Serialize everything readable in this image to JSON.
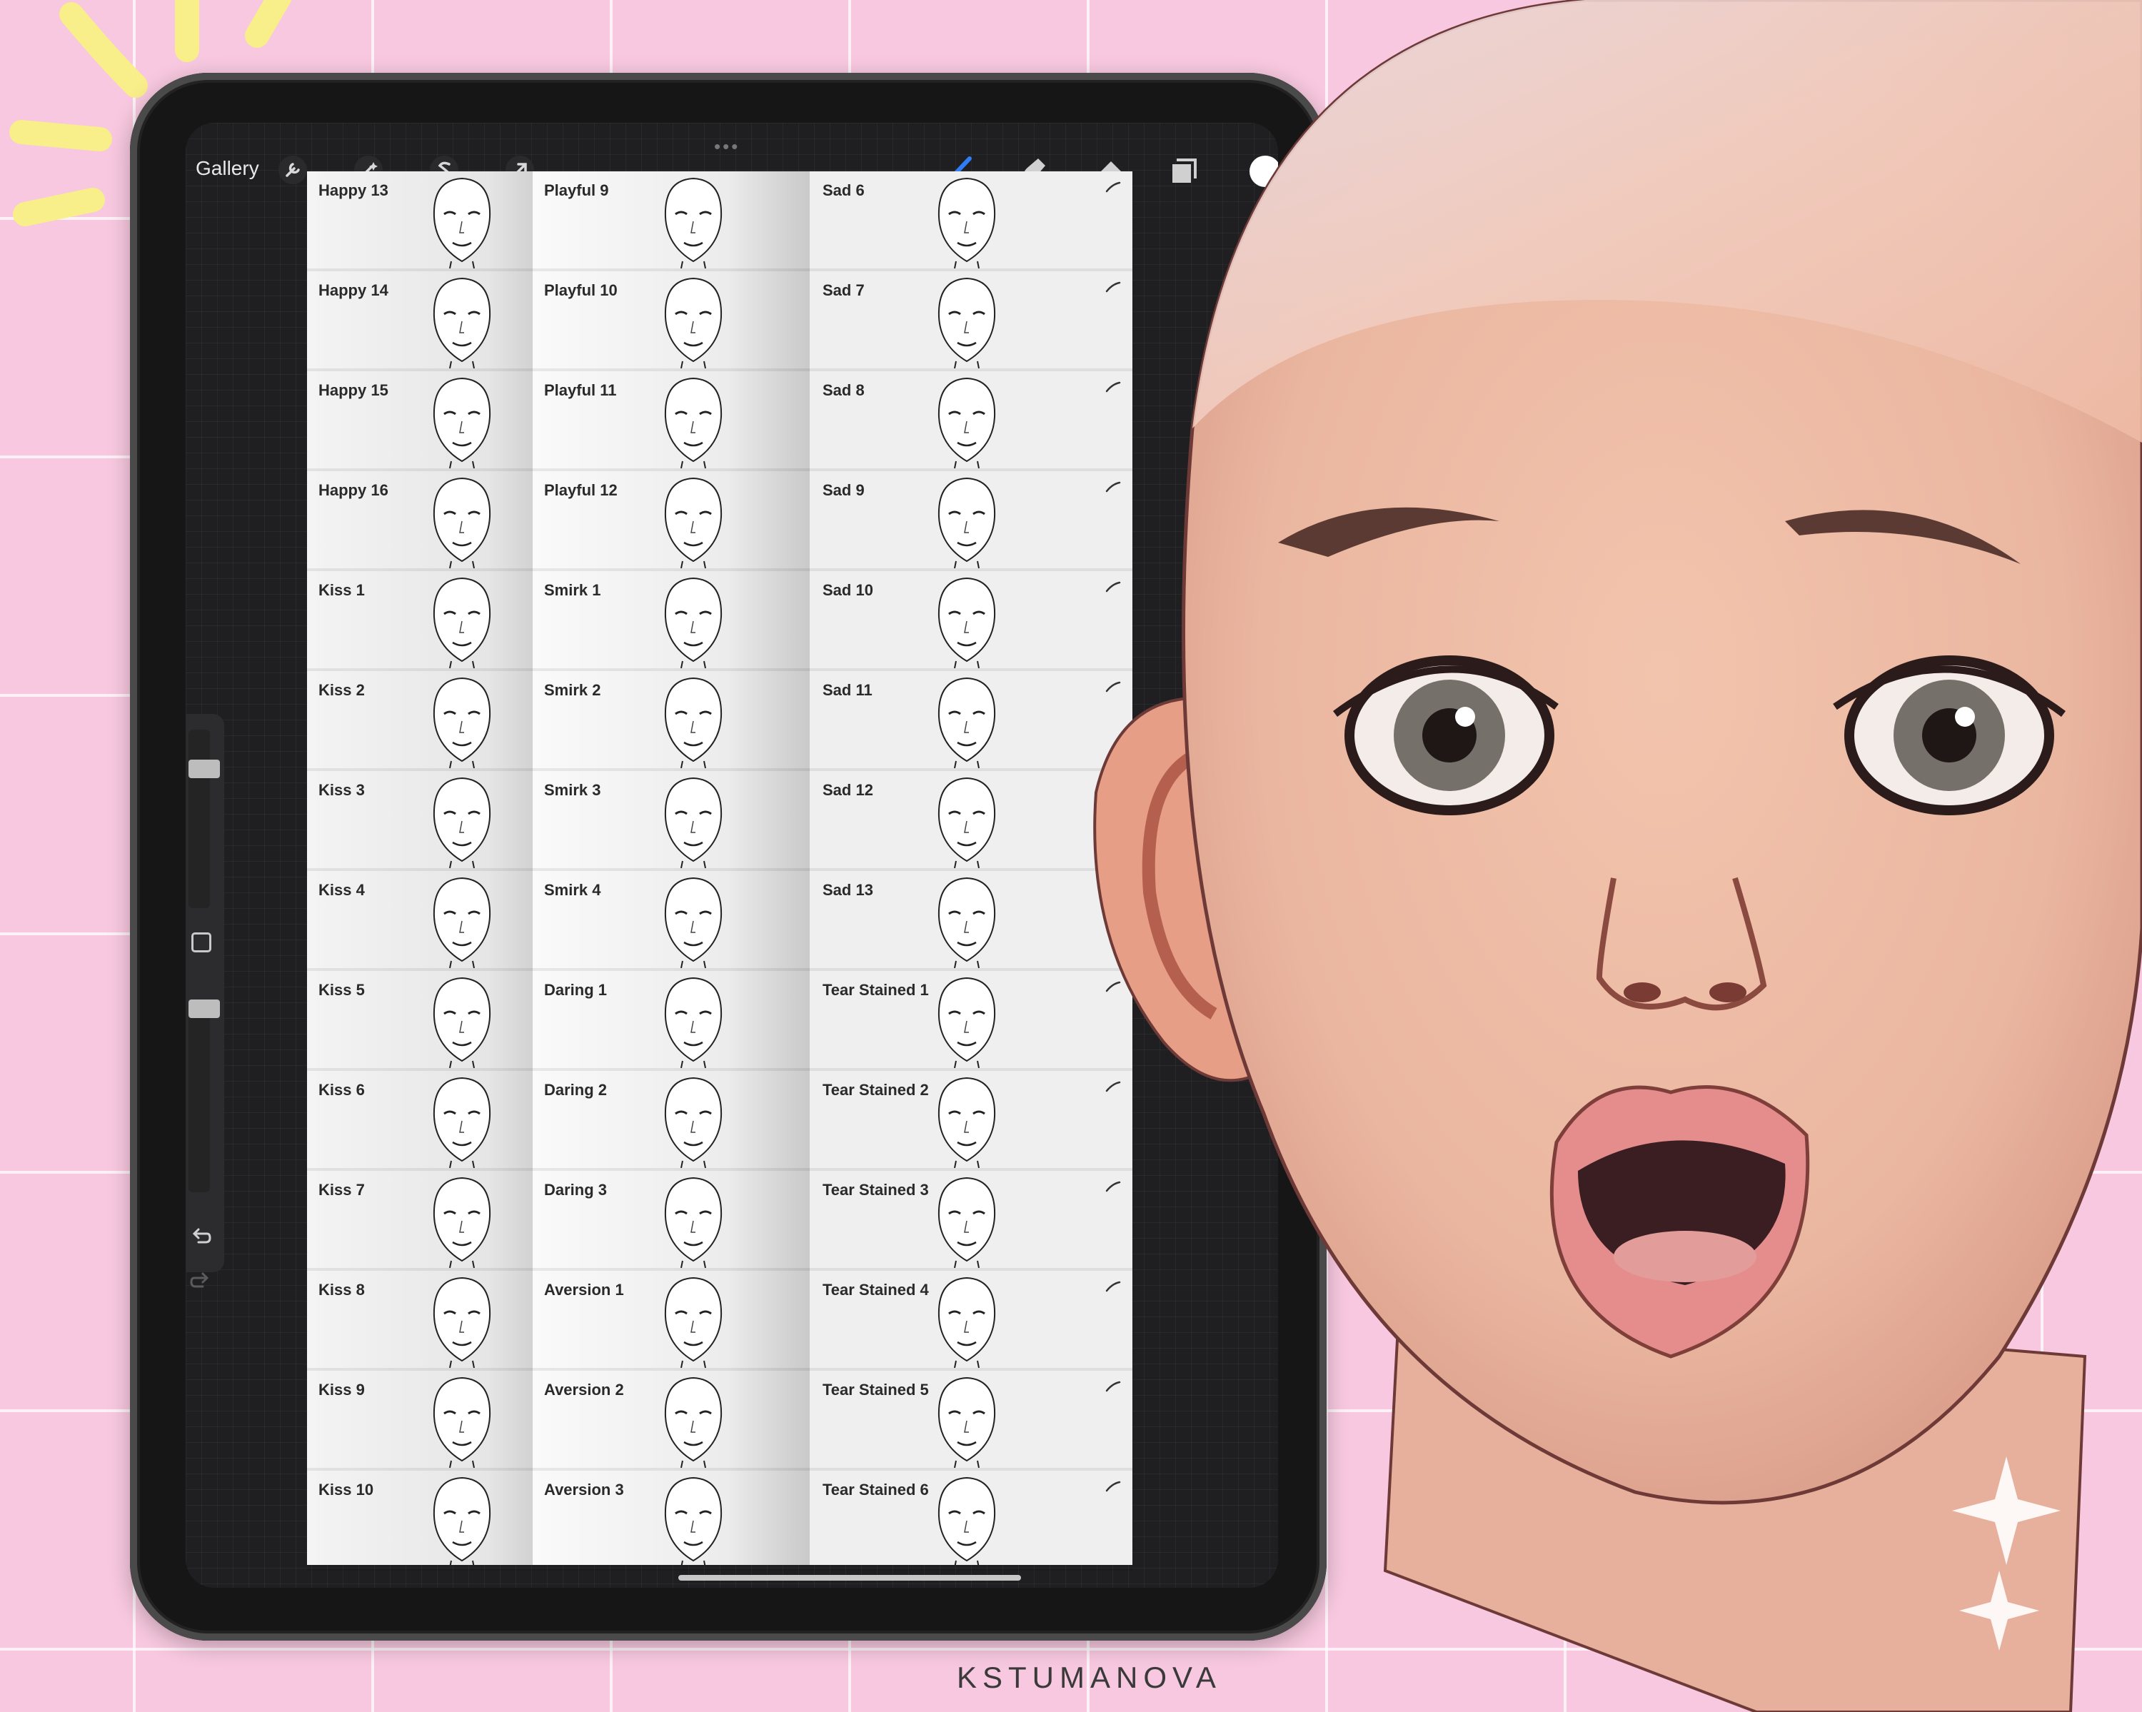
{
  "app": {
    "gallery_label": "Gallery",
    "tools_left": [
      {
        "icon": "wrench-icon"
      },
      {
        "icon": "magic-wand-icon"
      },
      {
        "icon": "selection-s-icon"
      },
      {
        "icon": "transform-arrow-icon"
      }
    ],
    "tools_right": [
      {
        "icon": "brush-icon",
        "color": "#2f7cf6"
      },
      {
        "icon": "smudge-icon"
      },
      {
        "icon": "eraser-icon"
      },
      {
        "icon": "layers-icon"
      }
    ],
    "current_color": "#ffffff",
    "more_dots": "•••"
  },
  "sidebar": {
    "icons": [
      "modify-square-icon",
      "undo-icon",
      "redo-icon"
    ]
  },
  "brushes": {
    "col1": [
      "Happy 13",
      "Happy 14",
      "Happy 15",
      "Happy 16",
      "Kiss 1",
      "Kiss 2",
      "Kiss 3",
      "Kiss 4",
      "Kiss 5",
      "Kiss 6",
      "Kiss 7",
      "Kiss 8",
      "Kiss 9",
      "Kiss 10"
    ],
    "col2": [
      "Playful 9",
      "Playful 10",
      "Playful 11",
      "Playful 12",
      "Smirk 1",
      "Smirk 2",
      "Smirk 3",
      "Smirk 4",
      "Daring 1",
      "Daring 2",
      "Daring 3",
      "Aversion 1",
      "Aversion 2",
      "Aversion 3"
    ],
    "col3": [
      "Sad 6",
      "Sad 7",
      "Sad 8",
      "Sad 9",
      "Sad 10",
      "Sad 11",
      "Sad 12",
      "Sad 13",
      "Tear Stained 1",
      "Tear Stained 2",
      "Tear Stained 3",
      "Tear Stained 4",
      "Tear Stained 5",
      "Tear Stained 6"
    ]
  },
  "brand": "KSTUMANOVA"
}
